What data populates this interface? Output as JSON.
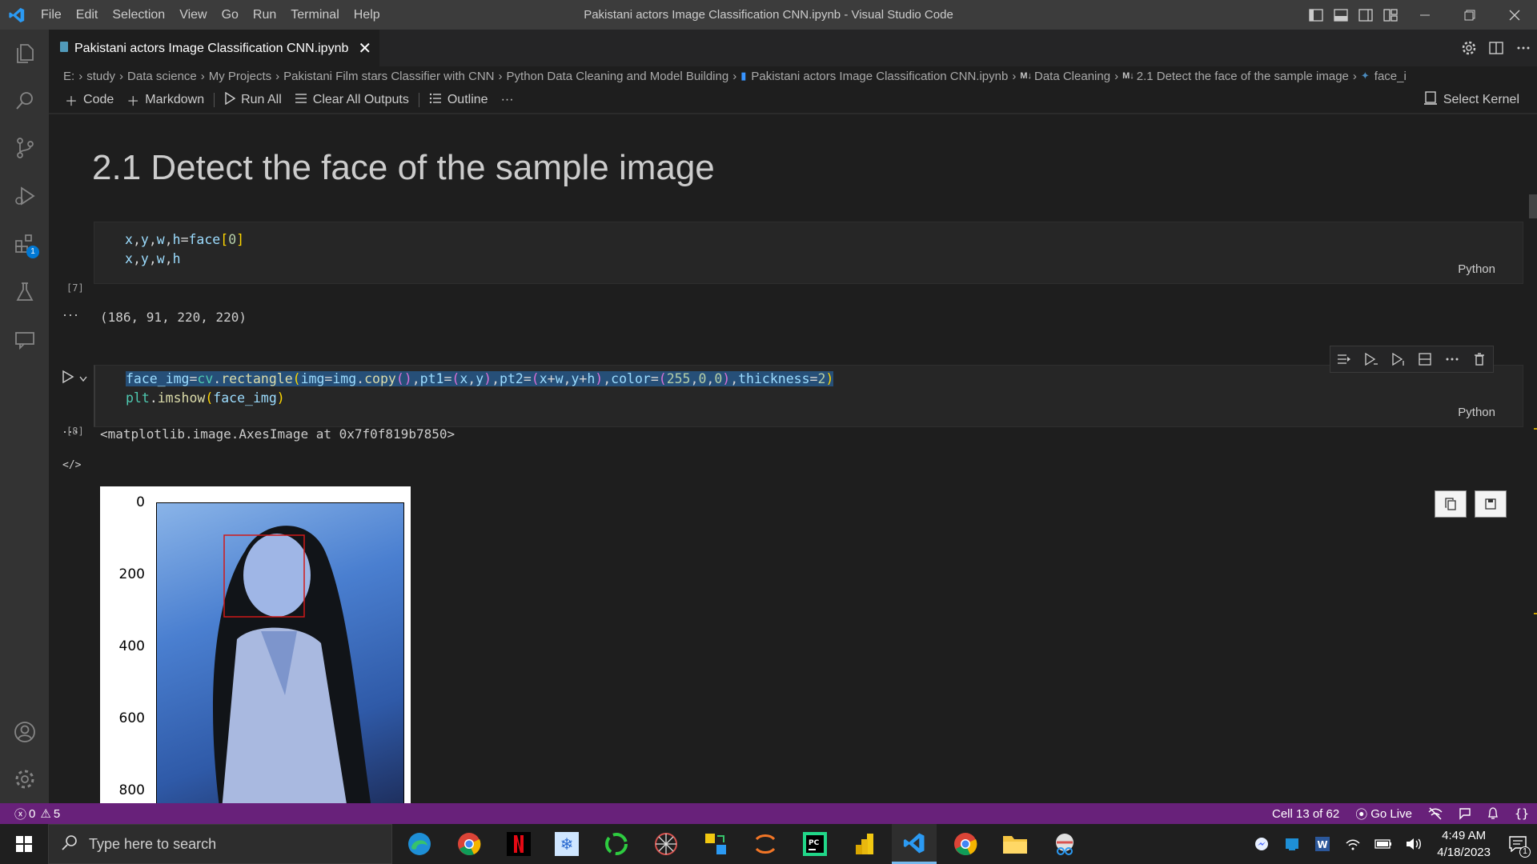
{
  "window": {
    "title": "Pakistani actors Image Classification CNN.ipynb - Visual Studio Code"
  },
  "menu": [
    "File",
    "Edit",
    "Selection",
    "View",
    "Go",
    "Run",
    "Terminal",
    "Help"
  ],
  "activity": {
    "extensions_badge": "1"
  },
  "tab": {
    "label": "Pakistani actors Image Classification CNN.ipynb",
    "close": "✕"
  },
  "breadcrumb": {
    "items": [
      "E:",
      "study",
      "Data science",
      "My Projects",
      "Pakistani Film stars Classifier with CNN",
      "Python Data Cleaning and Model Building"
    ],
    "file": "Pakistani actors Image Classification CNN.ipynb",
    "md_prefix": "M↓",
    "section1": "Data Cleaning",
    "section2": "2.1 Detect the face of the sample image",
    "tail": "face_i"
  },
  "toolbar": {
    "code": "Code",
    "markdown": "Markdown",
    "run_all": "Run All",
    "clear_outputs": "Clear All Outputs",
    "outline": "Outline",
    "more": "···",
    "kernel": "Select Kernel"
  },
  "notebook": {
    "heading": "2.1 Detect the face of the sample image",
    "cell1": {
      "exec_count": "[7]",
      "lang": "Python",
      "output": "(186, 91, 220, 220)"
    },
    "cell2": {
      "exec_count": "[8]",
      "lang": "Python",
      "output": "<matplotlib.image.AxesImage at 0x7f0f819b7850>"
    },
    "output_dots": "···",
    "plot": {
      "yticks": [
        "0",
        "200",
        "400",
        "600",
        "800"
      ]
    }
  },
  "status": {
    "errors": "0",
    "warnings": "5",
    "cell": "Cell 13 of 62",
    "go_live": "Go Live"
  },
  "taskbar": {
    "search_placeholder": "Type here to search",
    "time": "4:49 AM",
    "date": "4/18/2023",
    "notif_count": "1"
  }
}
